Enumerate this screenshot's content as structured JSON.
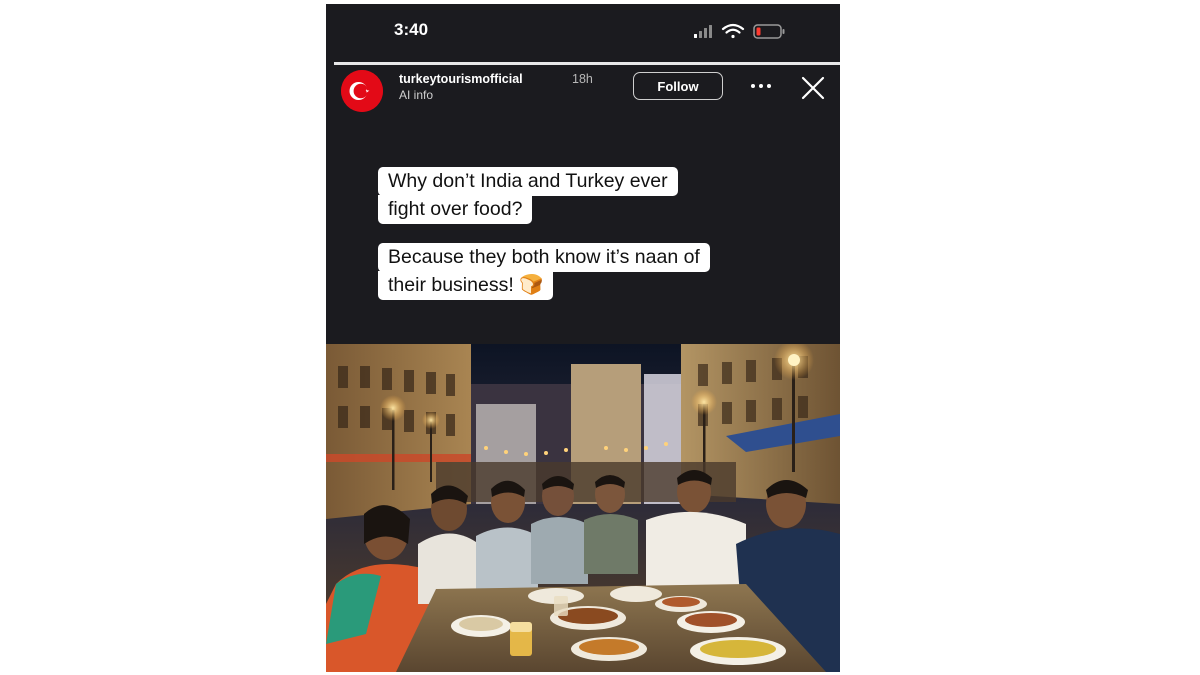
{
  "status_bar": {
    "time": "3:40",
    "icons": [
      "signal-icon",
      "wifi-icon",
      "battery-icon"
    ],
    "battery_color": "#ff3b30"
  },
  "story": {
    "progress": 1.0,
    "account": {
      "username": "turkeytourismofficial",
      "age": "18h",
      "sub_label": "AI info",
      "avatar": "turkey-flag-icon"
    },
    "follow_label": "Follow",
    "more_icon": "more-horizontal-icon",
    "close_icon": "close-icon",
    "caption_line1_a": "Why don’t India and Turkey ever",
    "caption_line1_b": "fight over food?",
    "caption_line2_a": "Because they both know it’s naan of",
    "caption_line2_b": "their business! 🍞",
    "image": "photo of people sharing a long dinner table on a night-time street"
  },
  "colors": {
    "background": "#1b1b1f",
    "flag_red": "#e30a17"
  }
}
